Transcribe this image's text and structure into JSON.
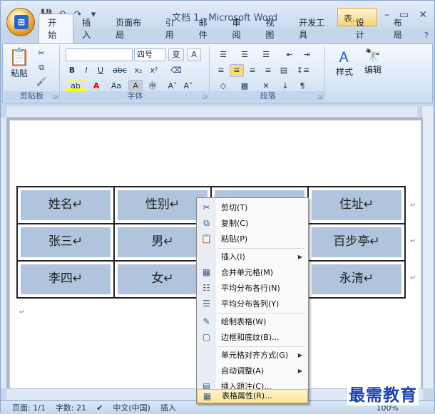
{
  "window": {
    "title": "文档 1 - Microsoft Word",
    "context_tab_title": "表...",
    "controls": [
      "–",
      "▭",
      "✕"
    ]
  },
  "tabs": [
    "开始",
    "插入",
    "页面布局",
    "引用",
    "邮件",
    "审阅",
    "视图",
    "开发工具",
    "设计",
    "布局"
  ],
  "ribbon": {
    "clipboard": {
      "label": "剪贴板",
      "paste": "粘贴"
    },
    "font": {
      "label": "字体",
      "font_name": "",
      "font_size": "四号",
      "wen": "变",
      "A_box": "A"
    },
    "paragraph": {
      "label": "段落"
    },
    "styles": {
      "label": "样式"
    },
    "editing": {
      "label": "编辑"
    }
  },
  "table": {
    "rows": [
      [
        "姓名↵",
        "性别↵",
        "",
        "住址↵"
      ],
      [
        "张三↵",
        "男↵",
        "",
        "百步亭↵"
      ],
      [
        "李四↵",
        "女↵",
        "",
        "永清↵"
      ]
    ]
  },
  "context_menu": {
    "items": [
      {
        "label": "剪切(T)",
        "icon": "scissors-icon",
        "glyph": "✂"
      },
      {
        "label": "复制(C)",
        "icon": "copy-icon",
        "glyph": "⧉"
      },
      {
        "label": "粘贴(P)",
        "icon": "paste-icon",
        "glyph": "📋"
      },
      {
        "label": "插入(I)",
        "icon": "",
        "glyph": "",
        "submenu": true
      },
      {
        "label": "合并单元格(M)",
        "icon": "merge-cells-icon",
        "glyph": "▦"
      },
      {
        "label": "平均分布各行(N)",
        "icon": "distribute-rows-icon",
        "glyph": "☷"
      },
      {
        "label": "平均分布各列(Y)",
        "icon": "distribute-columns-icon",
        "glyph": "☰"
      },
      {
        "label": "绘制表格(W)",
        "icon": "draw-table-icon",
        "glyph": "✎"
      },
      {
        "label": "边框和底纹(B)...",
        "icon": "borders-icon",
        "glyph": "▢"
      },
      {
        "label": "单元格对齐方式(G)",
        "icon": "",
        "glyph": "",
        "submenu": true
      },
      {
        "label": "自动调整(A)",
        "icon": "",
        "glyph": "",
        "submenu": true
      },
      {
        "label": "插入题注(C)...",
        "icon": "caption-icon",
        "glyph": "▤"
      },
      {
        "label": "表格属性(R)...",
        "icon": "table-properties-icon",
        "glyph": "▦",
        "highlighted": true
      }
    ]
  },
  "status_bar": {
    "page": "页面: 1/1",
    "words": "字数: 21",
    "language": "中文(中国)",
    "mode": "插入",
    "zoom": "100%"
  },
  "watermark": "最需教育"
}
